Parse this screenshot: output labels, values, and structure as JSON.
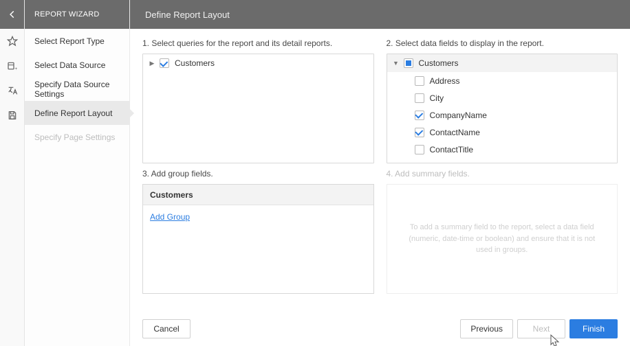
{
  "header": {
    "wizard_title": "REPORT WIZARD",
    "page_title": "Define Report Layout"
  },
  "sidebar": {
    "items": [
      {
        "label": "Select Report Type",
        "state": "normal"
      },
      {
        "label": "Select Data Source",
        "state": "normal"
      },
      {
        "label": "Specify Data Source Settings",
        "state": "normal"
      },
      {
        "label": "Define Report Layout",
        "state": "active"
      },
      {
        "label": "Specify Page Settings",
        "state": "disabled"
      }
    ]
  },
  "sections": {
    "queries_label": "1. Select queries for the report and its detail reports.",
    "fields_label": "2. Select data fields to display in the report.",
    "groups_label": "3. Add group fields.",
    "summary_label": "4. Add summary fields."
  },
  "queries": {
    "root": {
      "label": "Customers",
      "checked": true,
      "expanded": false
    }
  },
  "fields": {
    "root": {
      "label": "Customers",
      "state": "tri",
      "expanded": true
    },
    "items": [
      {
        "label": "Address",
        "checked": false
      },
      {
        "label": "City",
        "checked": false
      },
      {
        "label": "CompanyName",
        "checked": true
      },
      {
        "label": "ContactName",
        "checked": true
      },
      {
        "label": "ContactTitle",
        "checked": false
      }
    ]
  },
  "groups": {
    "header": "Customers",
    "add_link": "Add Group"
  },
  "summary": {
    "hint": "To add a summary field to the report, select a data field (numeric, date-time or boolean) and ensure that it is not used in groups."
  },
  "footer": {
    "cancel": "Cancel",
    "previous": "Previous",
    "next": "Next",
    "finish": "Finish"
  },
  "rail_icons": [
    "star-icon",
    "database-plus-icon",
    "translate-icon",
    "save-icon"
  ]
}
